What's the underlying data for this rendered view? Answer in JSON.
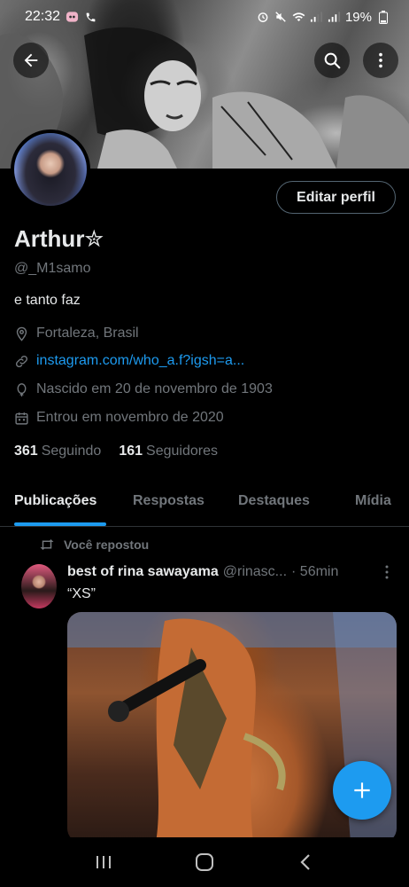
{
  "status_bar": {
    "time": "22:32",
    "battery": "19%"
  },
  "profile": {
    "name": "Arthur✮",
    "handle": "@_M1samo",
    "bio": "e tanto faz",
    "location": "Fortaleza, Brasil",
    "website": "instagram.com/who_a.f?igsh=a...",
    "birthday": "Nascido em 20 de novembro de 1903",
    "joined": "Entrou em novembro de 2020",
    "following_count": "361",
    "following_label": "Seguindo",
    "followers_count": "161",
    "followers_label": "Seguidores",
    "edit_button": "Editar perfil"
  },
  "tabs": [
    {
      "label": "Publicações",
      "active": true
    },
    {
      "label": "Respostas",
      "active": false
    },
    {
      "label": "Destaques",
      "active": false
    },
    {
      "label": "Mídia",
      "active": false
    }
  ],
  "post": {
    "repost_label": "Você repostou",
    "author": "best of rina sawayama",
    "handle": "@rinasc...",
    "time": "· 56min",
    "text": "“XS”"
  },
  "colors": {
    "accent": "#1d9bf0",
    "text_primary": "#e7e9ea",
    "text_secondary": "#71767b",
    "background": "#000000"
  }
}
